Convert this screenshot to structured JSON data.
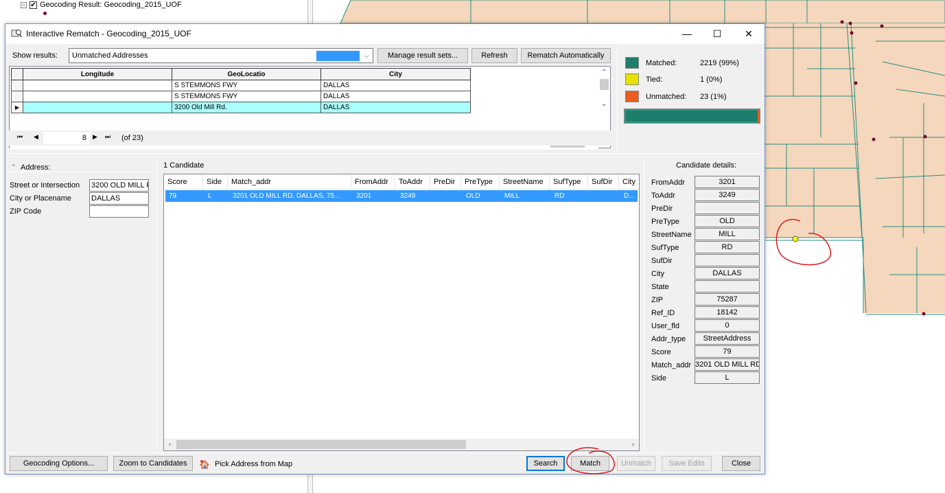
{
  "background": {
    "toc_layer_label": "Geocoding Result: Geocoding_2015_UOF",
    "map_colors": {
      "fill": "#f4d7bc",
      "lines": "#2a8c82",
      "points": "#7a0030",
      "highlight": "#ffff00",
      "annotation": "#e0161b"
    }
  },
  "dialog": {
    "title": "Interactive Rematch - Geocoding_2015_UOF",
    "window_controls": {
      "minimize": "—",
      "maximize": "☐",
      "close": "✕"
    },
    "show_results_label": "Show results:",
    "show_results_value": "Unmatched Addresses",
    "buttons": {
      "manage": "Manage result sets...",
      "refresh": "Refresh",
      "rematch_auto": "Rematch Automatically"
    },
    "grid": {
      "columns": [
        "Longitude",
        "GeoLocatio",
        "City"
      ],
      "rows": [
        {
          "longitude": "",
          "geolocatio": "S STEMMONS FWY",
          "city": "DALLAS",
          "selected": false
        },
        {
          "longitude": "",
          "geolocatio": "S STEMMONS FWY",
          "city": "DALLAS",
          "selected": false
        },
        {
          "longitude": "",
          "geolocatio": "3200 Old Mill Rd.",
          "city": "DALLAS",
          "selected": true
        }
      ],
      "current_record": "8",
      "of_text": "(of 23)"
    },
    "stats": {
      "matched_label": "Matched:",
      "matched_value": "2219 (99%)",
      "matched_color": "#1f7d6b",
      "tied_label": "Tied:",
      "tied_value": "1 (0%)",
      "tied_color": "#e8e000",
      "unmatched_label": "Unmatched:",
      "unmatched_value": "23 (1%)",
      "unmatched_color": "#e85d20",
      "progress_fraction": 0.99
    },
    "address": {
      "header": "Address:",
      "fields": [
        {
          "label": "Street or Intersection",
          "value": "3200 OLD MILL R"
        },
        {
          "label": "City or Placename",
          "value": "DALLAS"
        },
        {
          "label": "ZIP Code",
          "value": ""
        }
      ]
    },
    "candidates": {
      "count_label": "1 Candidate",
      "columns": [
        "Score",
        "Side",
        "Match_addr",
        "FromAddr",
        "ToAddr",
        "PreDir",
        "PreType",
        "StreetName",
        "SufType",
        "SufDir",
        "City"
      ],
      "rows": [
        {
          "score": "79",
          "side": "L",
          "match_addr": "3201 OLD MILL RD, DALLAS, 75...",
          "fromaddr": "3201",
          "toaddr": "3249",
          "predir": "",
          "pretype": "OLD",
          "streetname": "MILL",
          "suftype": "RD",
          "sufdir": "",
          "city": "D..."
        }
      ]
    },
    "details": {
      "header": "Candidate details:",
      "fields": [
        {
          "label": "FromAddr",
          "value": "3201"
        },
        {
          "label": "ToAddr",
          "value": "3249"
        },
        {
          "label": "PreDir",
          "value": ""
        },
        {
          "label": "PreType",
          "value": "OLD"
        },
        {
          "label": "StreetName",
          "value": "MILL"
        },
        {
          "label": "SufType",
          "value": "RD"
        },
        {
          "label": "SufDir",
          "value": ""
        },
        {
          "label": "City",
          "value": "DALLAS"
        },
        {
          "label": "State",
          "value": ""
        },
        {
          "label": "ZIP",
          "value": "75287"
        },
        {
          "label": "Ref_ID",
          "value": "18142"
        },
        {
          "label": "User_fld",
          "value": "0"
        },
        {
          "label": "Addr_type",
          "value": "StreetAddress"
        },
        {
          "label": "Score",
          "value": "79"
        },
        {
          "label": "Match_addr",
          "value": "3201 OLD MILL RD,"
        },
        {
          "label": "Side",
          "value": "L"
        }
      ]
    },
    "footer": {
      "geocoding_options": "Geocoding Options...",
      "zoom_candidates": "Zoom to Candidates",
      "pick_address": "Pick Address from Map",
      "search": "Search",
      "match": "Match",
      "unmatch": "Unmatch",
      "save_edits": "Save Edits",
      "close": "Close"
    }
  }
}
